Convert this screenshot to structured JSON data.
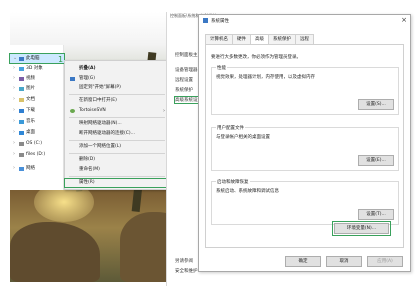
{
  "tree": {
    "items": [
      {
        "label": "此电脑",
        "icon": "computer-icon",
        "selected": true
      },
      {
        "label": "3D 对象",
        "icon": "folder-3d-icon"
      },
      {
        "label": "视频",
        "icon": "video-folder-icon"
      },
      {
        "label": "图片",
        "icon": "pictures-folder-icon"
      },
      {
        "label": "文档",
        "icon": "documents-folder-icon"
      },
      {
        "label": "下载",
        "icon": "download-folder-icon"
      },
      {
        "label": "音乐",
        "icon": "music-folder-icon"
      },
      {
        "label": "桌面",
        "icon": "desktop-folder-icon"
      },
      {
        "label": "OS (C:)",
        "icon": "drive-icon"
      },
      {
        "label": "files (D:)",
        "icon": "drive-icon"
      },
      {
        "label": "网络",
        "icon": "network-icon"
      }
    ]
  },
  "context_menu": {
    "items": [
      {
        "label": "折叠(A)",
        "bold": true
      },
      {
        "label": "管理(G)",
        "icon": "shield-icon"
      },
      {
        "label": "固定到\"开始\"屏幕(P)"
      },
      {
        "label": "在新窗口中打开(E)"
      },
      {
        "label": "TortoiseSVN",
        "submenu": "›",
        "icon": "tortoise-icon"
      },
      {
        "label": "映射网络驱动器(N)..."
      },
      {
        "label": "断开网络驱动器的连接(C)..."
      },
      {
        "label": "添加一个网络位置(L)"
      },
      {
        "label": "删除(D)"
      },
      {
        "label": "重命名(M)"
      },
      {
        "label": "属性(R)"
      }
    ]
  },
  "steps": {
    "one": "1.",
    "two": "2.",
    "three": "3.",
    "four": "4."
  },
  "system_window": {
    "title": "控制面板\\系统和安全\\系统",
    "links": [
      "控制面板主页",
      "设备管理器",
      "远程设置",
      "系统保护",
      "高级系统设置"
    ],
    "see_also": "另请参阅",
    "security": "安全和维护"
  },
  "dialog": {
    "title": "系统属性",
    "close": "×",
    "tabs": [
      "计算机名",
      "硬件",
      "高级",
      "系统保护",
      "远程"
    ],
    "active_tab": 2,
    "admin_note": "要进行大多数更改，你必须作为管理员登录。",
    "performance": {
      "title": "性能",
      "desc": "视觉效果，处理器计划，内存使用，以及虚拟内存",
      "button": "设置(S)..."
    },
    "profiles": {
      "title": "用户配置文件",
      "desc": "与登录帐户相关的桌面设置",
      "button": "设置(E)..."
    },
    "startup": {
      "title": "启动和故障恢复",
      "desc": "系统启动、系统故障和调试信息",
      "button": "设置(T)..."
    },
    "env_button": "环境变量(N)...",
    "ok": "确定",
    "cancel": "取消",
    "apply": "应用(A)"
  },
  "colors": {
    "highlight": "#3aa15c",
    "selection": "#cce8ff",
    "accent": "#3b78c4"
  }
}
